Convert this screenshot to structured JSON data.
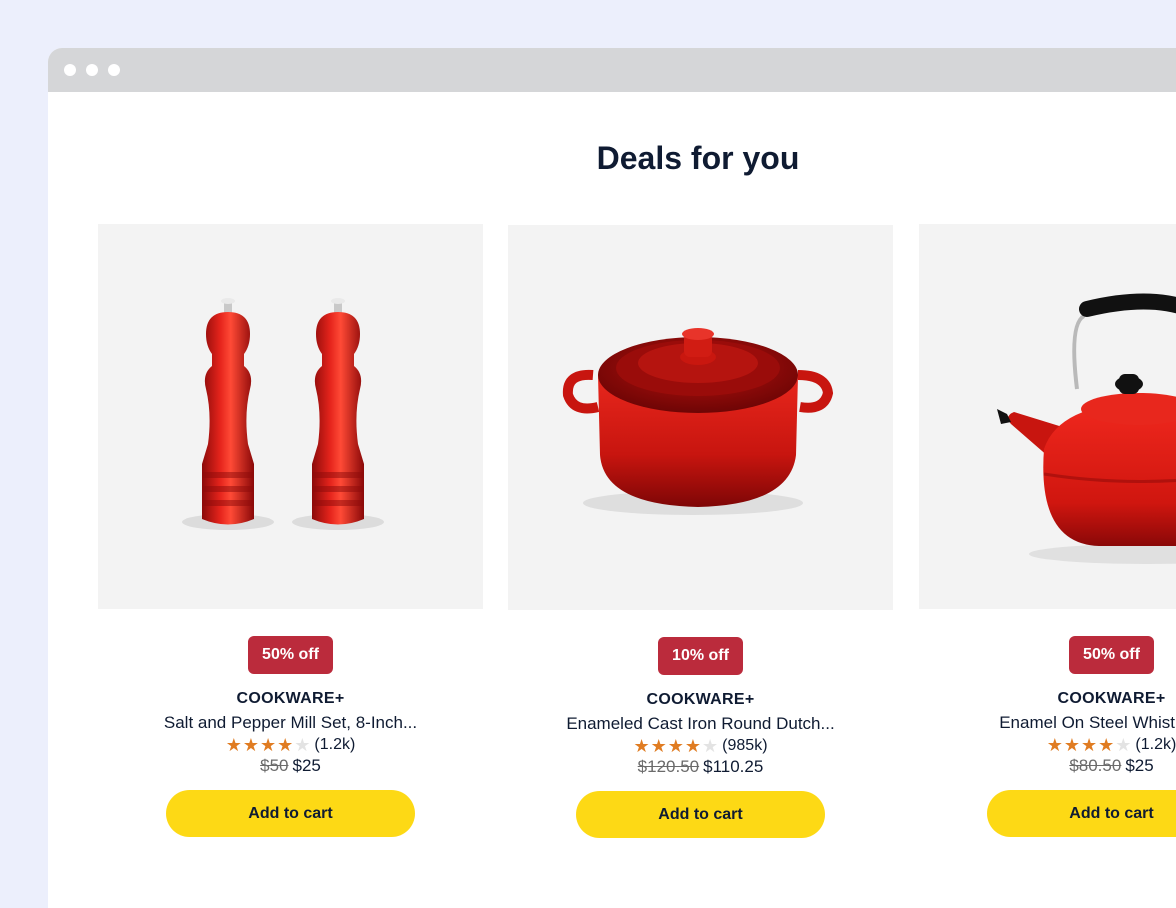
{
  "page": {
    "heading": "Deals for you"
  },
  "colors": {
    "badge": "#bb2b3c",
    "button": "#fdd915",
    "star": "#e07c22",
    "text": "#0f1b32"
  },
  "products": [
    {
      "image_icon": "pepper-mill-set-image",
      "discount": "50% off",
      "brand": "COOKWARE+",
      "name": "Salt and Pepper Mill Set, 8-Inch...",
      "stars": 4,
      "reviews": "(1.2k)",
      "old_price": "$50",
      "price": "$25",
      "button": "Add to cart"
    },
    {
      "image_icon": "dutch-oven-image",
      "discount": "10% off",
      "brand": "COOKWARE+",
      "name": "Enameled Cast Iron Round Dutch...",
      "stars": 4,
      "reviews": "(985k)",
      "old_price": "$120.50",
      "price": "$110.25",
      "button": "Add to cart"
    },
    {
      "image_icon": "tea-kettle-image",
      "discount": "50% off",
      "brand": "COOKWARE+",
      "name": "Enamel On Steel Whistling Te",
      "stars": 4,
      "reviews": "(1.2k)",
      "old_price": "$80.50",
      "price": "$25",
      "button": "Add to cart"
    }
  ]
}
